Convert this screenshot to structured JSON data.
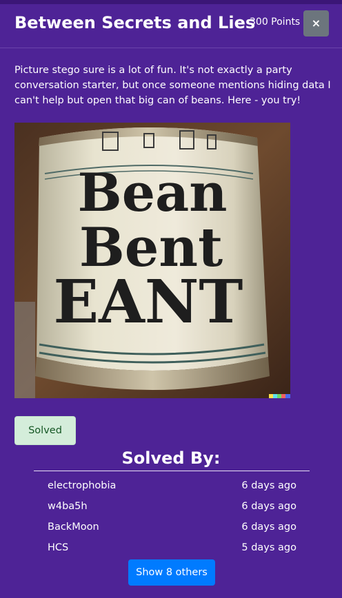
{
  "modal": {
    "title": "Between Secrets and Lies",
    "points": "300 Points",
    "close_label": "×"
  },
  "challenge": {
    "description": "Picture stego sure is a lot of fun. It's not exactly a party conversation starter, but once someone mentions hiding data I can't help but open that big can of beans. Here - you try!",
    "image": {
      "label_lines": [
        "Bean",
        "Bent",
        "EANT"
      ]
    }
  },
  "status": {
    "solved_label": "Solved"
  },
  "solved_by": {
    "title": "Solved By:",
    "solvers": [
      {
        "name": "electrophobia",
        "time": "6 days ago"
      },
      {
        "name": "w4ba5h",
        "time": "6 days ago"
      },
      {
        "name": "BackMoon",
        "time": "6 days ago"
      },
      {
        "name": "HCS",
        "time": "5 days ago"
      }
    ],
    "show_more_label": "Show 8 others"
  },
  "colors": {
    "background": "#4e2396",
    "close_button": "#6c757d",
    "solved_badge": "#d4edda",
    "solved_text": "#155724",
    "primary_button": "#007bff"
  }
}
